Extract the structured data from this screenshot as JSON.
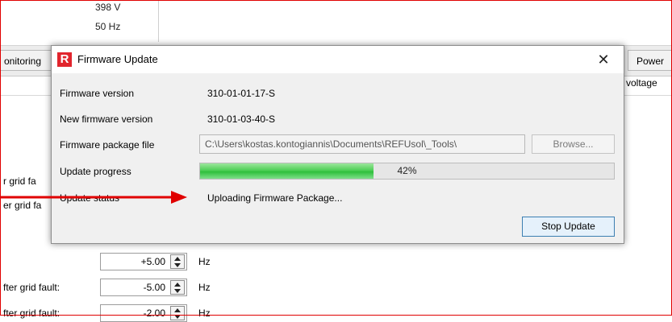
{
  "background": {
    "voltage_value": "398 V",
    "frequency_value": "50 Hz",
    "tab_left_label": "onitoring",
    "tab_right_label": "Power",
    "right_subtext": "l voltage",
    "left_labels": [
      "r grid fa",
      "er grid fa",
      "fter grid fault:",
      "fter grid fault:"
    ],
    "spinners": [
      {
        "value": "+5.00",
        "unit": "Hz"
      },
      {
        "value": "-5.00",
        "unit": "Hz"
      },
      {
        "value": "-2.00",
        "unit": "Hz"
      }
    ]
  },
  "dialog": {
    "title": "Firmware Update",
    "logo_letter": "R",
    "close_glyph": "✕",
    "firmware_version_label": "Firmware version",
    "firmware_version_value": "310-01-01-17-S",
    "new_firmware_version_label": "New firmware version",
    "new_firmware_version_value": "310-01-03-40-S",
    "package_file_label": "Firmware package file",
    "package_file_value": "C:\\Users\\kostas.kontogiannis\\Documents\\REFUsol\\_Tools\\",
    "browse_label": "Browse...",
    "update_progress_label": "Update progress",
    "progress_percent": 42,
    "progress_text": "42%",
    "update_status_label": "Update status",
    "update_status_value": "Uploading Firmware Package...",
    "stop_update_label": "Stop Update"
  },
  "colors": {
    "annotation_red": "#e00000",
    "logo_red": "#e1252d",
    "progress_green": "#3fc74a"
  },
  "icons": [
    "refusol-logo-icon",
    "close-icon",
    "spinner-up-icon",
    "spinner-down-icon",
    "annotation-arrow-icon"
  ]
}
